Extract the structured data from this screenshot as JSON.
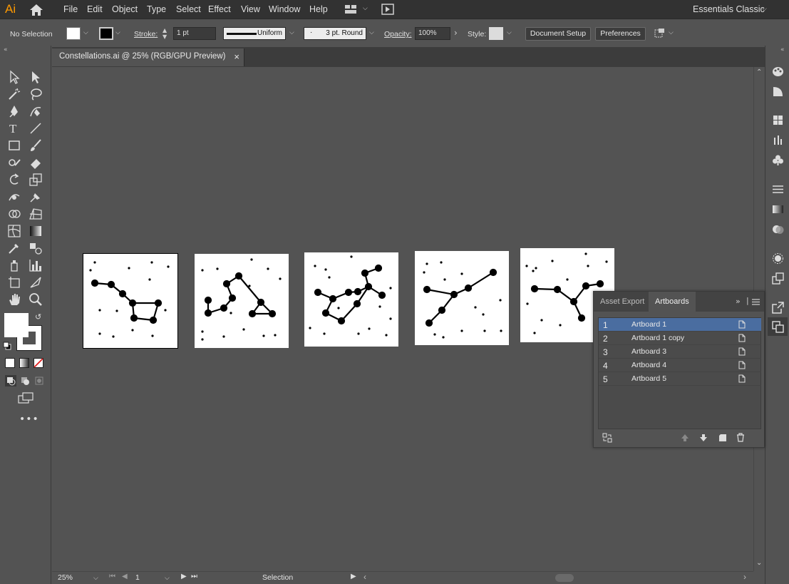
{
  "app": {
    "logo": "Ai",
    "workspace": "Essentials Classic"
  },
  "menu": [
    "File",
    "Edit",
    "Object",
    "Type",
    "Select",
    "Effect",
    "View",
    "Window",
    "Help"
  ],
  "control": {
    "selection": "No Selection",
    "stroke_label": "Stroke:",
    "stroke_weight": "1 pt",
    "stroke_style": "Uniform",
    "brush": "3 pt. Round",
    "opacity_label": "Opacity:",
    "opacity_value": "100%",
    "style_label": "Style:",
    "document_setup": "Document Setup",
    "preferences": "Preferences"
  },
  "document": {
    "tab_title": "Constellations.ai @ 25% (RGB/GPU Preview)",
    "close": "×"
  },
  "status": {
    "zoom": "25%",
    "artboard_nav": "1",
    "tool": "Selection"
  },
  "panel": {
    "tabs": [
      "Asset Export",
      "Artboards"
    ],
    "active_tab": "Artboards",
    "artboards": [
      {
        "num": "1",
        "name": "Artboard 1",
        "selected": true
      },
      {
        "num": "2",
        "name": "Artboard 1 copy",
        "selected": false
      },
      {
        "num": "3",
        "name": "Artboard 3",
        "selected": false
      },
      {
        "num": "4",
        "name": "Artboard 4",
        "selected": false
      },
      {
        "num": "5",
        "name": "Artboard 5",
        "selected": false
      }
    ]
  },
  "colors": {
    "ui_dark": "#323232",
    "ui_mid": "#535353",
    "accent": "#ff9a00",
    "selection_blue": "#4a6da0"
  }
}
